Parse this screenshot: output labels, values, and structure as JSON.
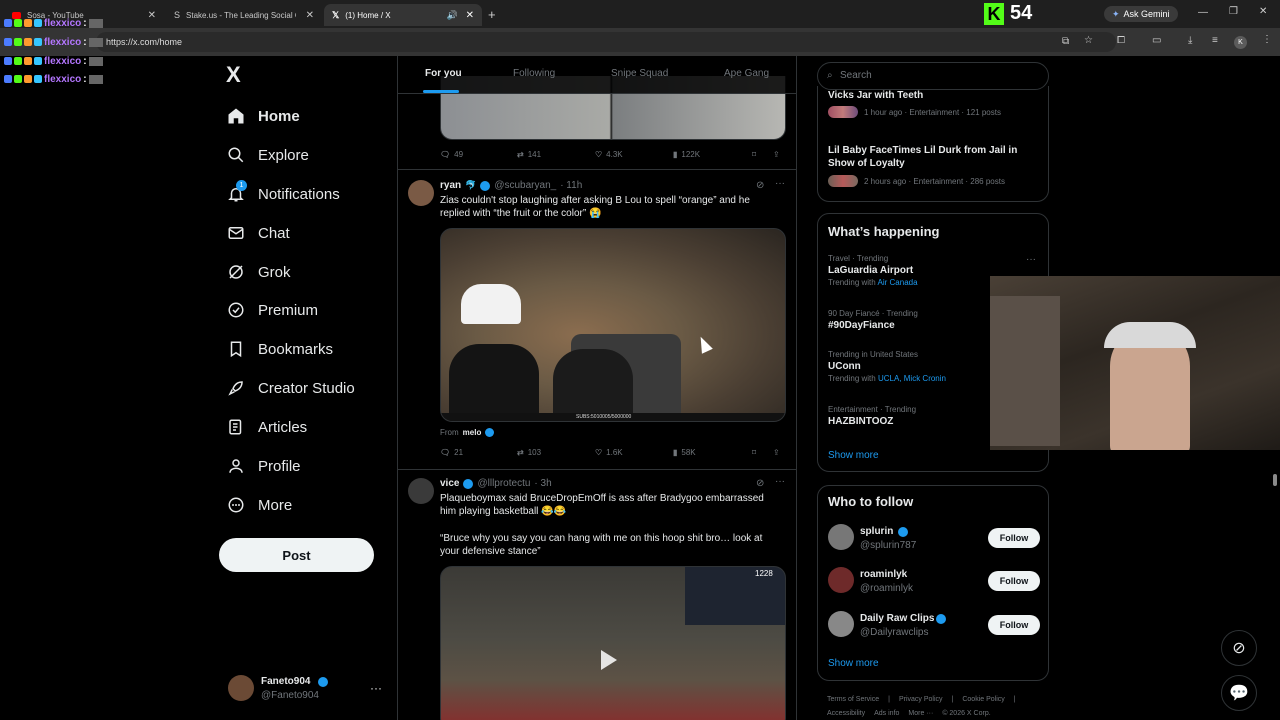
{
  "browser": {
    "tabs": [
      {
        "title": "Sosa - YouTube"
      },
      {
        "title": "Stake.us - The Leading Social C"
      },
      {
        "title": "(1) Home / X"
      }
    ],
    "url": "https://x.com/home",
    "gemini_label": "Ask Gemini",
    "profile_letter": "K"
  },
  "overlay": {
    "kick_count": "54",
    "chat_lines": [
      {
        "user": "flexxico",
        "sep": ":"
      },
      {
        "user": "flexxico",
        "sep": ":"
      },
      {
        "user": "flexxico",
        "sep": ":"
      },
      {
        "user": "flexxico",
        "sep": ":"
      }
    ]
  },
  "nav": {
    "logo": "X",
    "items": [
      {
        "label": "Home",
        "icon": "home-icon"
      },
      {
        "label": "Explore",
        "icon": "search-icon"
      },
      {
        "label": "Notifications",
        "icon": "bell-icon",
        "badge": "1"
      },
      {
        "label": "Chat",
        "icon": "mail-icon"
      },
      {
        "label": "Grok",
        "icon": "grok-icon"
      },
      {
        "label": "Premium",
        "icon": "premium-icon"
      },
      {
        "label": "Bookmarks",
        "icon": "bookmark-icon"
      },
      {
        "label": "Creator Studio",
        "icon": "rocket-icon"
      },
      {
        "label": "Articles",
        "icon": "articles-icon"
      },
      {
        "label": "Profile",
        "icon": "person-icon"
      },
      {
        "label": "More",
        "icon": "more-circle-icon"
      }
    ],
    "post_label": "Post",
    "account": {
      "name": "Faneto904",
      "handle": "@Faneto904",
      "more": "···"
    }
  },
  "timeline": {
    "tabs": [
      {
        "label": "For you"
      },
      {
        "label": "Following"
      },
      {
        "label": "Snipe Squad"
      },
      {
        "label": "Ape Gang"
      }
    ],
    "post0": {
      "replies": "49",
      "reposts": "141",
      "likes": "4.3K",
      "views": "122K"
    },
    "post1": {
      "name": "ryan",
      "handle": "@scubaryan_",
      "time": "· 11h",
      "text": "Zias couldn't stop laughing after asking B Lou to spell “orange” and he replied with “the fruit or the color” 😭",
      "from_prefix": "From",
      "from_user": "melo",
      "video_caption": "SUBS:5010005/5000000",
      "replies": "21",
      "reposts": "103",
      "likes": "1.6K",
      "views": "58K"
    },
    "post2": {
      "name": "vice",
      "handle": "@lllprotectu",
      "time": "· 3h",
      "text1": "Plaqueboymax said BruceDropEmOff is ass after Bradygoo embarrassed him playing basketball 😂😂",
      "text2": "“Bruce why you say you can hang with me on this hoop shit bro… look at your defensive stance”",
      "video_badge": "1228"
    }
  },
  "right": {
    "search_placeholder": "Search",
    "top_trends": [
      {
        "title": "Vicks Jar with Teeth",
        "meta": "1 hour ago · Entertainment · 121 posts"
      },
      {
        "title": "Lil Baby FaceTimes Lil Durk from Jail in Show of Loyalty",
        "meta": "2 hours ago · Entertainment · 286 posts"
      }
    ],
    "whats_happening": {
      "title": "What’s happening",
      "trends": [
        {
          "context": "Travel · Trending",
          "title": "LaGuardia Airport",
          "with_prefix": "Trending with",
          "with": "Air Canada"
        },
        {
          "context": "90 Day Fiancé · Trending",
          "title": "#90DayFiance"
        },
        {
          "context": "Trending in United States",
          "title": "UConn",
          "with_prefix": "Trending with",
          "with": "UCLA, Mick Cronin"
        },
        {
          "context": "Entertainment · Trending",
          "title": "HAZBINTOOZ"
        }
      ],
      "show_more": "Show more"
    },
    "who_to_follow": {
      "title": "Who to follow",
      "users": [
        {
          "name": "splurin",
          "handle": "@splurin787",
          "verified": true
        },
        {
          "name": "roaminlyk",
          "handle": "@roaminlyk",
          "verified": false
        },
        {
          "name": "Daily Raw Clips",
          "handle": "@Dailyrawclips",
          "verified": true
        }
      ],
      "follow_label": "Follow",
      "show_more": "Show more"
    },
    "footer": {
      "links": [
        "Terms of Service",
        "|",
        "Privacy Policy",
        "|",
        "Cookie Policy",
        "|"
      ],
      "links2": [
        "Accessibility",
        "Ads info",
        "More ···",
        "© 2026 X Corp."
      ]
    }
  },
  "colors": {
    "accent": "#1d9bf0",
    "kick": "#53fc18",
    "bg": "#000000",
    "chat_name": "#b476ff"
  }
}
